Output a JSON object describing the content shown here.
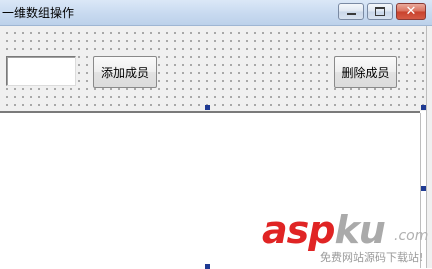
{
  "window": {
    "title": "一维数组操作",
    "controls": {
      "minimize_icon": "minimize-icon",
      "maximize_icon": "maximize-icon",
      "close_icon": "close-icon",
      "close_glyph": "✕"
    }
  },
  "form": {
    "input_value": "",
    "add_button_label": "添加成员",
    "delete_button_label": "删除成员"
  },
  "watermark": {
    "main_red": "asp",
    "main_gray": "ku",
    "suffix": ".com",
    "subtitle": "免费网站源码下载站!"
  },
  "colors": {
    "titlebar": "#c8daf0",
    "close_button": "#c8412c",
    "selection_handle": "#1f3a93",
    "watermark_red": "#e02424"
  }
}
